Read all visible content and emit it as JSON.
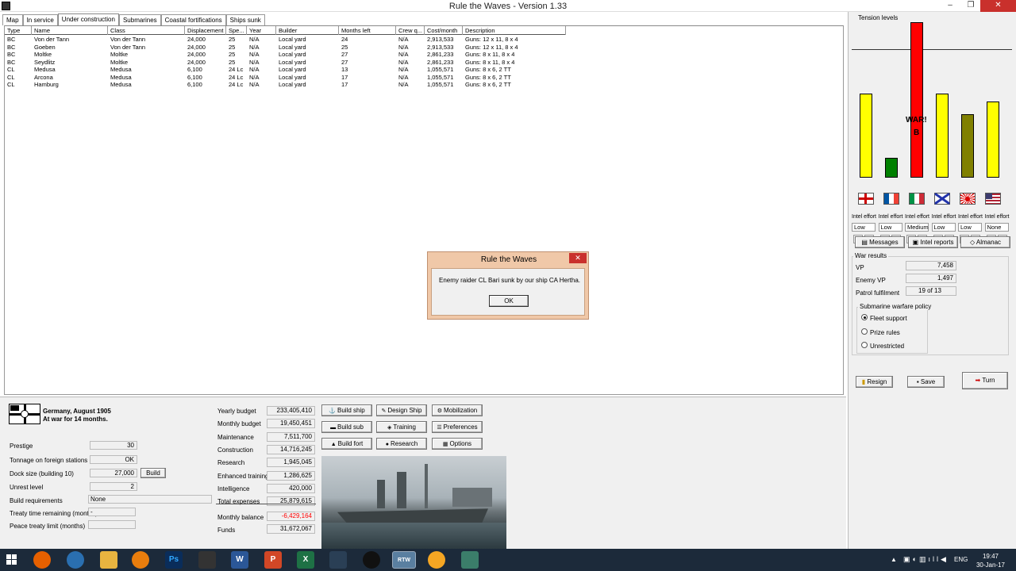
{
  "window": {
    "title": "Rule the Waves - Version 1.33",
    "minimize": "–",
    "maximize": "❐",
    "close": "✕"
  },
  "tabs": [
    "Map",
    "In service",
    "Under construction",
    "Submarines",
    "Coastal fortifications",
    "Ships sunk"
  ],
  "active_tab": "Under construction",
  "table": {
    "columns": [
      "Type",
      "Name",
      "Class",
      "Displacement",
      "Spe...",
      "Year",
      "Builder",
      "Months left",
      "Crew q...",
      "Cost/month",
      "Description"
    ],
    "rows": [
      [
        "BC",
        "Von der Tann",
        "Von der Tann",
        "24,000",
        "25",
        "N/A",
        "Local yard",
        "24",
        "N/A",
        "2,913,533",
        "Guns: 12 x 11, 8 x 4"
      ],
      [
        "BC",
        "Goeben",
        "Von der Tann",
        "24,000",
        "25",
        "N/A",
        "Local yard",
        "25",
        "N/A",
        "2,913,533",
        "Guns: 12 x 11, 8 x 4"
      ],
      [
        "BC",
        "Moltke",
        "Moltke",
        "24,000",
        "25",
        "N/A",
        "Local yard",
        "27",
        "N/A",
        "2,861,233",
        "Guns: 8 x 11, 8 x 4"
      ],
      [
        "BC",
        "Seydlitz",
        "Moltke",
        "24,000",
        "25",
        "N/A",
        "Local yard",
        "27",
        "N/A",
        "2,861,233",
        "Guns: 8 x 11, 8 x 4"
      ],
      [
        "CL",
        "Medusa",
        "Medusa",
        "6,100",
        "24 Lc",
        "N/A",
        "Local yard",
        "13",
        "N/A",
        "1,055,571",
        "Guns: 8 x 6, 2 TT"
      ],
      [
        "CL",
        "Arcona",
        "Medusa",
        "6,100",
        "24 Lc",
        "N/A",
        "Local yard",
        "17",
        "N/A",
        "1,055,571",
        "Guns: 8 x 6, 2 TT"
      ],
      [
        "CL",
        "Hamburg",
        "Medusa",
        "6,100",
        "24 Lc",
        "N/A",
        "Local yard",
        "17",
        "N/A",
        "1,055,571",
        "Guns: 8 x 6, 2 TT"
      ]
    ]
  },
  "tension": {
    "title": "Tension levels",
    "levels": [
      0.54,
      0.13,
      1.0,
      0.54,
      0.41,
      0.49
    ],
    "colors": [
      "#ffff00",
      "#008000",
      "#ff0000",
      "#ffff00",
      "#808000",
      "#ffff00"
    ],
    "war_label": "WAR!",
    "war_sub": "B",
    "nations": [
      "uk-flag-icon",
      "france-flag-icon",
      "italy-flag-icon",
      "russia-flag-icon",
      "japan-flag-icon",
      "usa-flag-icon"
    ]
  },
  "intel": {
    "label": "Intel effort",
    "levels": [
      "Low",
      "Low",
      "Medium",
      "Low",
      "Low",
      "None"
    ],
    "plus": "+",
    "minus": "-"
  },
  "side_buttons": {
    "messages": "Messages",
    "intel_reports": "Intel reports",
    "almanac": "Almanac"
  },
  "war_results": {
    "title": "War results",
    "vp_label": "VP",
    "vp": "7,458",
    "enemy_vp_label": "Enemy VP",
    "enemy_vp": "1,497",
    "patrol_label": "Patrol fulfilment",
    "patrol": "19 of 13"
  },
  "sub_policy": {
    "title": "Submarine warfare policy",
    "options": [
      "Fleet support",
      "Prize rules",
      "Unrestricted"
    ],
    "selected": 0
  },
  "actions": {
    "resign": "Resign",
    "save": "Save",
    "turn": "Turn"
  },
  "status": {
    "nation_date": "Germany, August 1905",
    "war_status": "At war for 14 months.",
    "prestige_label": "Prestige",
    "prestige": "30",
    "tonnage_label": "Tonnage on foreign stations",
    "tonnage": "OK",
    "dock_label": "Dock size (building 10)",
    "dock": "27,000",
    "build_btn": "Build",
    "unrest_label": "Unrest level",
    "unrest": "2",
    "build_req_label": "Build requirements",
    "build_req": "None",
    "treaty_label": "Treaty time remaining (months)",
    "treaty": "-",
    "peace_label": "Peace treaty limit (months)",
    "peace": ""
  },
  "budget": {
    "yearly_label": "Yearly budget",
    "yearly": "233,405,410",
    "monthly_label": "Monthly budget",
    "monthly": "19,450,451",
    "maintenance_label": "Maintenance",
    "maintenance": "7,511,700",
    "construction_label": "Construction",
    "construction": "14,716,245",
    "research_label": "Research",
    "research": "1,945,045",
    "training_label": "Enhanced training",
    "training": "1,286,625",
    "intel_label": "Intelligence",
    "intel": "420,000",
    "total_label": "Total expenses",
    "total": "25,879,615",
    "balance_label": "Monthly balance",
    "balance": "-6,429,164",
    "funds_label": "Funds",
    "funds": "31,672,067",
    "negative_color": "#ff0000"
  },
  "main_buttons": {
    "build_ship": "Build ship",
    "design_ship": "Design Ship",
    "mobilization": "Mobilization",
    "build_sub": "Build sub",
    "training": "Training",
    "preferences": "Preferences",
    "build_fort": "Build fort",
    "research": "Research",
    "options": "Options"
  },
  "dialog": {
    "title": "Rule the Waves",
    "message": "Enemy raider CL Bari sunk by our ship CA Hertha.",
    "ok": "OK",
    "close": "✕"
  },
  "taskbar": {
    "time": "19:47",
    "date": "30-Jan-17",
    "lang": "ENG",
    "apps": [
      "start-icon",
      "firefox-icon",
      "thunderbird-icon",
      "explorer-icon",
      "blender-icon",
      "photoshop-icon",
      "inkscape-icon",
      "word-icon",
      "powerpoint-icon",
      "excel-icon",
      "steam-game-icon",
      "obs-icon",
      "rtw-icon",
      "headphones-icon",
      "app-icon"
    ],
    "ps": "Ps",
    "w": "W",
    "p": "P",
    "x": "X",
    "rtw": "RTW"
  }
}
